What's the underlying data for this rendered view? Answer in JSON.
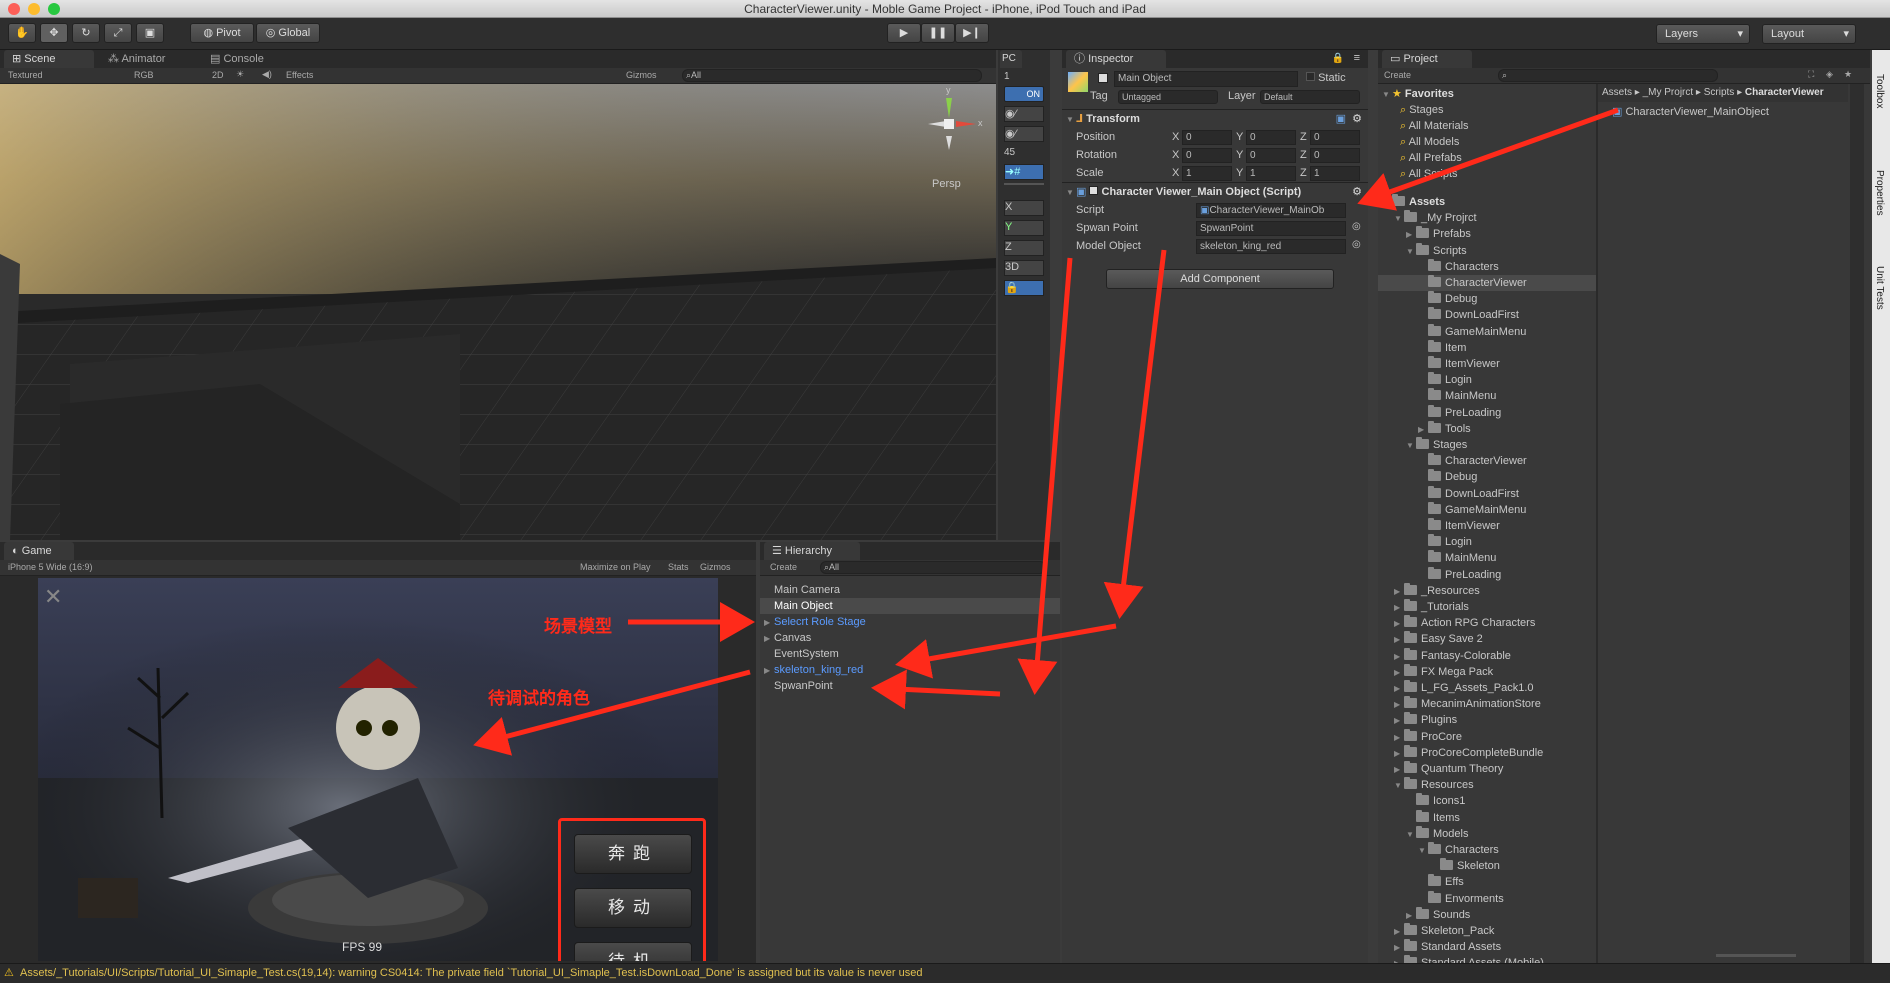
{
  "window": {
    "title": "CharacterViewer.unity - Moble Game Project - iPhone, iPod Touch and iPad"
  },
  "toolbar": {
    "pivot": "Pivot",
    "global": "Global",
    "layers": "Layers",
    "layout": "Layout"
  },
  "scene": {
    "tabs": [
      "Scene",
      "Animator",
      "Console"
    ],
    "textured": "Textured",
    "rgb": "RGB",
    "mode2d": "2D",
    "effects": "Effects",
    "gizmos": "Gizmos",
    "search_placeholder": "All",
    "persp": "Persp",
    "gizmo_x": "x",
    "gizmo_y": "y"
  },
  "sidepanel": {
    "tab": "PC",
    "value1": "1",
    "on": "ON",
    "value45": "45",
    "axes": [
      "X",
      "Y",
      "Z",
      "3D"
    ]
  },
  "inspector": {
    "tab": "Inspector",
    "object_name": "Main Object",
    "static": "Static",
    "tag_label": "Tag",
    "tag_value": "Untagged",
    "layer_label": "Layer",
    "layer_value": "Default",
    "transform": {
      "title": "Transform",
      "rows": [
        {
          "label": "Position",
          "x": "0",
          "y": "0",
          "z": "0"
        },
        {
          "label": "Rotation",
          "x": "0",
          "y": "0",
          "z": "0"
        },
        {
          "label": "Scale",
          "x": "1",
          "y": "1",
          "z": "1"
        }
      ]
    },
    "script_comp": {
      "title": "Character Viewer_Main Object (Script)",
      "rows": [
        {
          "label": "Script",
          "value": "CharacterViewer_MainOb"
        },
        {
          "label": "Spwan Point",
          "value": "SpwanPoint"
        },
        {
          "label": "Model Object",
          "value": "skeleton_king_red"
        }
      ]
    },
    "add_component": "Add Component"
  },
  "project": {
    "tab": "Project",
    "create": "Create",
    "breadcrumb": [
      "Assets",
      "_My Projrct",
      "Scripts",
      "CharacterViewer"
    ],
    "selected_file": "CharacterViewer_MainObject",
    "favorites_label": "Favorites",
    "favorites": [
      "Stages",
      "All Materials",
      "All Models",
      "All Prefabs",
      "All Scripts"
    ],
    "tree": [
      {
        "label": "Assets",
        "d": 0,
        "t": "open",
        "bold": true
      },
      {
        "label": "_My Projrct",
        "d": 1,
        "t": "open"
      },
      {
        "label": "Prefabs",
        "d": 2,
        "t": "closed"
      },
      {
        "label": "Scripts",
        "d": 2,
        "t": "open"
      },
      {
        "label": "Characters",
        "d": 3,
        "t": ""
      },
      {
        "label": "CharacterViewer",
        "d": 3,
        "t": "",
        "sel": true
      },
      {
        "label": "Debug",
        "d": 3,
        "t": ""
      },
      {
        "label": "DownLoadFirst",
        "d": 3,
        "t": ""
      },
      {
        "label": "GameMainMenu",
        "d": 3,
        "t": ""
      },
      {
        "label": "Item",
        "d": 3,
        "t": ""
      },
      {
        "label": "ItemViewer",
        "d": 3,
        "t": ""
      },
      {
        "label": "Login",
        "d": 3,
        "t": ""
      },
      {
        "label": "MainMenu",
        "d": 3,
        "t": ""
      },
      {
        "label": "PreLoading",
        "d": 3,
        "t": ""
      },
      {
        "label": "Tools",
        "d": 3,
        "t": "closed"
      },
      {
        "label": "Stages",
        "d": 2,
        "t": "open"
      },
      {
        "label": "CharacterViewer",
        "d": 3,
        "t": ""
      },
      {
        "label": "Debug",
        "d": 3,
        "t": ""
      },
      {
        "label": "DownLoadFirst",
        "d": 3,
        "t": ""
      },
      {
        "label": "GameMainMenu",
        "d": 3,
        "t": ""
      },
      {
        "label": "ItemViewer",
        "d": 3,
        "t": ""
      },
      {
        "label": "Login",
        "d": 3,
        "t": ""
      },
      {
        "label": "MainMenu",
        "d": 3,
        "t": ""
      },
      {
        "label": "PreLoading",
        "d": 3,
        "t": ""
      },
      {
        "label": "_Resources",
        "d": 1,
        "t": "closed"
      },
      {
        "label": "_Tutorials",
        "d": 1,
        "t": "closed"
      },
      {
        "label": "Action RPG Characters",
        "d": 1,
        "t": "closed"
      },
      {
        "label": "Easy Save 2",
        "d": 1,
        "t": "closed"
      },
      {
        "label": "Fantasy-Colorable",
        "d": 1,
        "t": "closed"
      },
      {
        "label": "FX Mega Pack",
        "d": 1,
        "t": "closed"
      },
      {
        "label": "L_FG_Assets_Pack1.0",
        "d": 1,
        "t": "closed"
      },
      {
        "label": "MecanimAnimationStore",
        "d": 1,
        "t": "closed"
      },
      {
        "label": "Plugins",
        "d": 1,
        "t": "closed"
      },
      {
        "label": "ProCore",
        "d": 1,
        "t": "closed"
      },
      {
        "label": "ProCoreCompleteBundle",
        "d": 1,
        "t": "closed"
      },
      {
        "label": "Quantum Theory",
        "d": 1,
        "t": "closed"
      },
      {
        "label": "Resources",
        "d": 1,
        "t": "open"
      },
      {
        "label": "Icons1",
        "d": 2,
        "t": ""
      },
      {
        "label": "Items",
        "d": 2,
        "t": ""
      },
      {
        "label": "Models",
        "d": 2,
        "t": "open"
      },
      {
        "label": "Characters",
        "d": 3,
        "t": "open"
      },
      {
        "label": "Skeleton",
        "d": 4,
        "t": ""
      },
      {
        "label": "Effs",
        "d": 3,
        "t": ""
      },
      {
        "label": "Envorments",
        "d": 3,
        "t": ""
      },
      {
        "label": "Sounds",
        "d": 2,
        "t": "closed"
      },
      {
        "label": "Skeleton_Pack",
        "d": 1,
        "t": "closed"
      },
      {
        "label": "Standard Assets",
        "d": 1,
        "t": "closed"
      },
      {
        "label": "Standard Assets (Mobile)",
        "d": 1,
        "t": "closed"
      }
    ]
  },
  "side_tabs": [
    "Toolbox",
    "Properties",
    "Unit Tests"
  ],
  "game": {
    "tab": "Game",
    "resolution": "iPhone 5 Wide (16:9)",
    "maximize": "Maximize on Play",
    "stats": "Stats",
    "gizmos": "Gizmos",
    "fps": "FPS 99",
    "buttons": [
      "奔跑",
      "移动",
      "待机"
    ]
  },
  "hierarchy": {
    "tab": "Hierarchy",
    "create": "Create",
    "search_placeholder": "All",
    "items": [
      {
        "label": "Main Camera"
      },
      {
        "label": "Main Object",
        "sel": true
      },
      {
        "label": "Selecrt Role Stage",
        "blue": true,
        "tri": true
      },
      {
        "label": "Canvas",
        "tri": true
      },
      {
        "label": "EventSystem"
      },
      {
        "label": "skeleton_king_red",
        "blue": true,
        "tri": true
      },
      {
        "label": "SpwanPoint"
      }
    ]
  },
  "annotations": {
    "scene_model": "场景模型",
    "debug_character": "待调试的角色"
  },
  "status": {
    "message": "Assets/_Tutorials/UI/Scripts/Tutorial_UI_Simaple_Test.cs(19,14): warning CS0414: The private field `Tutorial_UI_Simaple_Test.isDownLoad_Done' is assigned but its value is never used"
  },
  "colors": {
    "accent": "#ff2a1a",
    "selection": "#3d5a80",
    "link_blue": "#5b9bff"
  }
}
